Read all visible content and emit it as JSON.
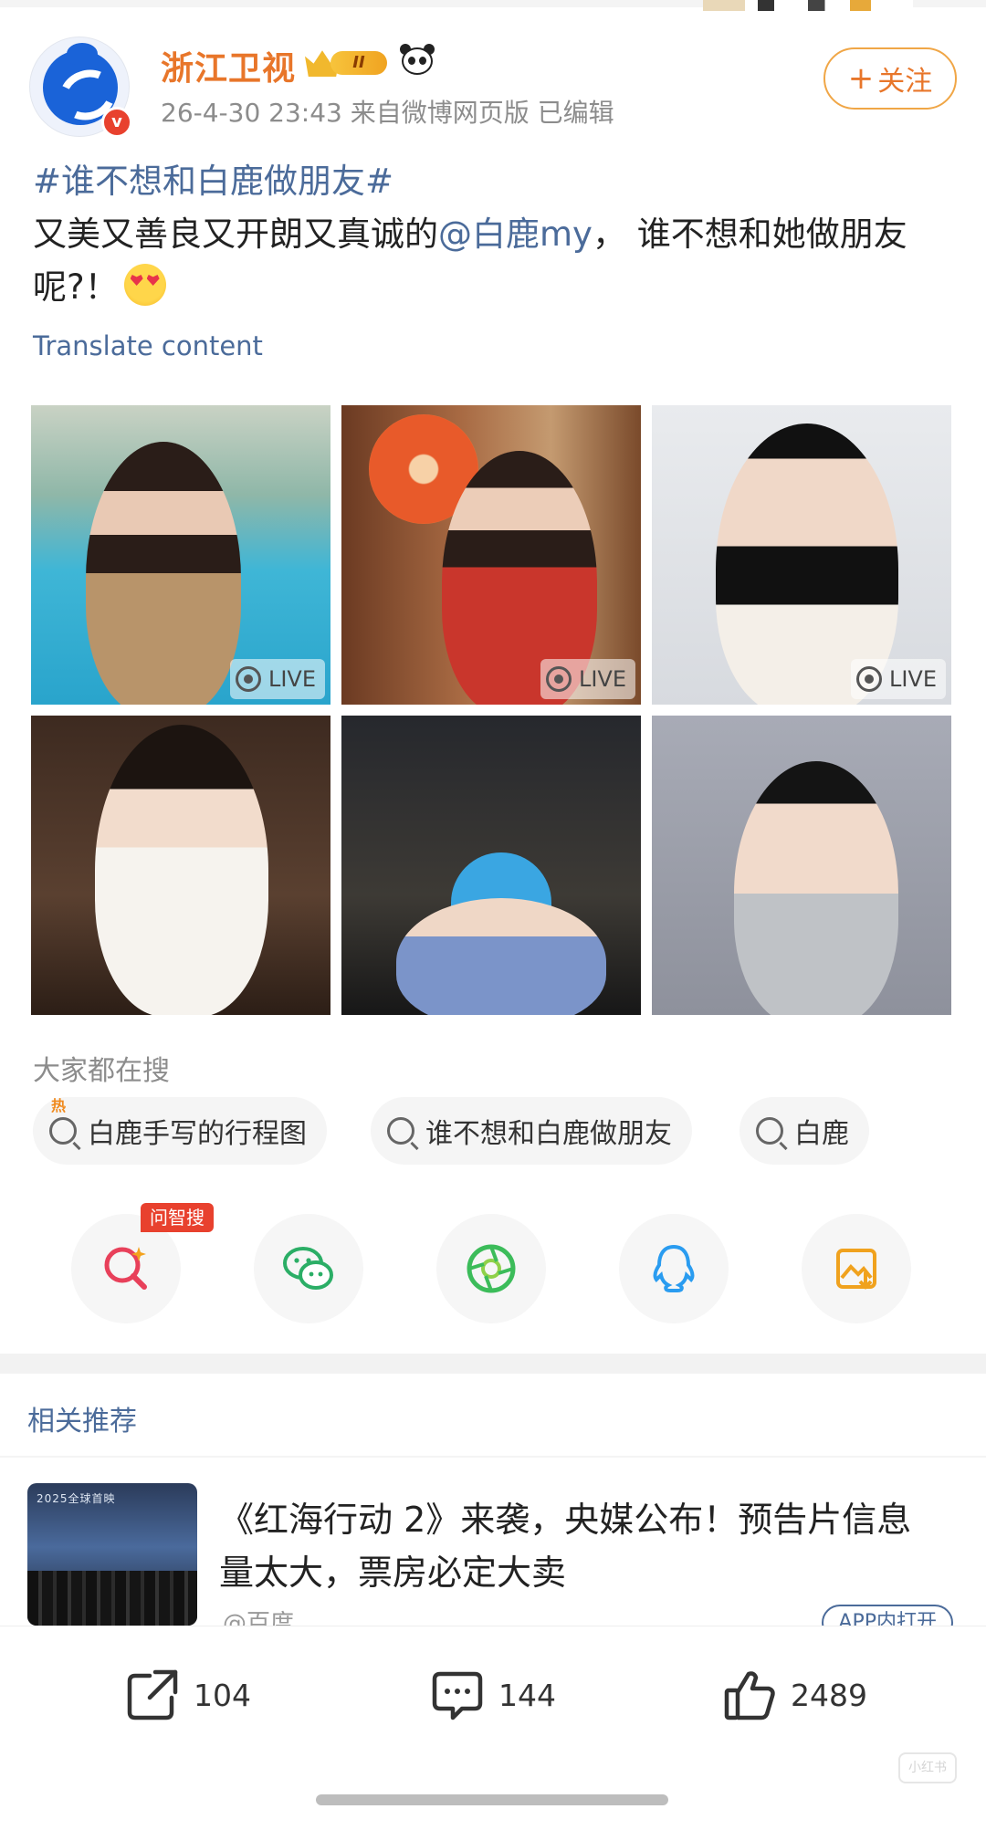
{
  "post": {
    "author": "浙江卫视",
    "level": "II",
    "meta": "26-4-30 23:43  来自微博网页版  已编辑",
    "follow_label": "关注",
    "hashtag": "#谁不想和白鹿做朋友#",
    "text_before": "又美又善良又开朗又真诚的",
    "mention": "@白鹿my",
    "text_after": "， 谁不想和她做朋友呢?！",
    "translate": "Translate content",
    "images": [
      {
        "live": "LIVE"
      },
      {
        "live": "LIVE"
      },
      {
        "live": "LIVE"
      },
      {
        "live": ""
      },
      {
        "live": ""
      },
      {
        "live": ""
      }
    ]
  },
  "search": {
    "title": "大家都在搜",
    "hot_tag": "热",
    "chips": [
      "白鹿手写的行程图",
      "谁不想和白鹿做朋友",
      "白鹿"
    ]
  },
  "share": {
    "ai_tag": "问智搜",
    "icons": [
      "ai-search-icon",
      "wechat-icon",
      "moments-icon",
      "qq-icon",
      "save-image-icon"
    ]
  },
  "recommend": {
    "title": "相关推荐",
    "thumb_text": "2025全球首映",
    "headline": "《红海行动 2》来袭，央媒公布！预告片信息量太大，票房必定大卖",
    "source": "@百度",
    "open_label": "APP内打开"
  },
  "actions": {
    "repost": "104",
    "comment": "144",
    "like": "2489"
  },
  "watermark": "小红书",
  "colors": {
    "accent_orange": "#e8762a",
    "link_blue": "#4b6b9a",
    "badge_red": "#e8412e"
  }
}
